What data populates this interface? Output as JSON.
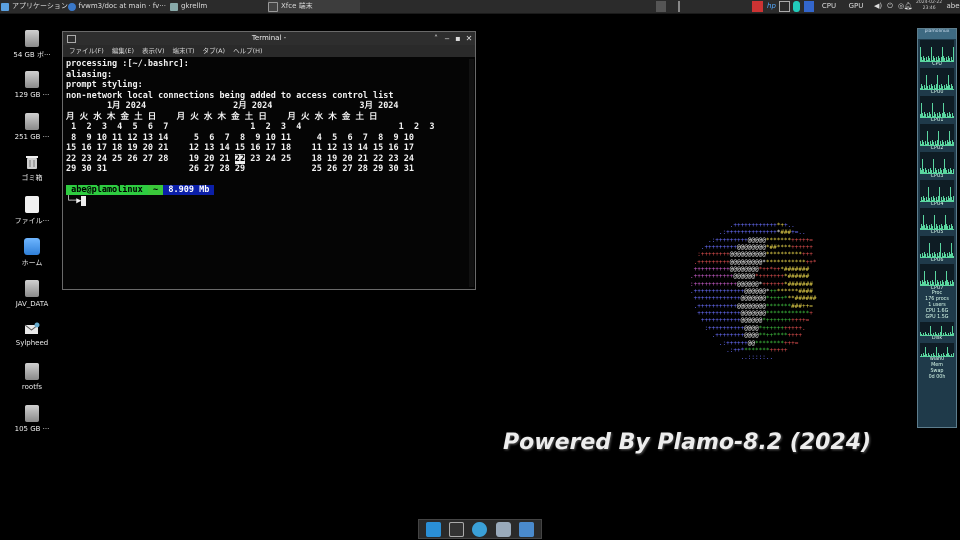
{
  "topbar": {
    "apps_menu": "アプリケーション",
    "tasks": [
      {
        "label": "fvwm3/doc at main · fv···"
      },
      {
        "label": "gkrellm"
      },
      {
        "label": "Xfce 端末"
      }
    ],
    "tray": {
      "cpu": "CPU",
      "gpu": "GPU",
      "user": "abe"
    },
    "clock": {
      "date": "2024-02-22",
      "time": "23:46"
    }
  },
  "desktop_icons": [
    {
      "label": "54 GB ボ···"
    },
    {
      "label": "129 GB ···"
    },
    {
      "label": "251 GB ···"
    },
    {
      "label": "ゴミ箱"
    },
    {
      "label": "ファイル···"
    },
    {
      "label": "ホーム"
    },
    {
      "label": "JAV_DATA"
    },
    {
      "label": "Sylpheed"
    },
    {
      "label": "rootfs"
    },
    {
      "label": "105 GB ···"
    }
  ],
  "terminal": {
    "title": "Terminal -",
    "menu": [
      "ファイル(F)",
      "編集(E)",
      "表示(V)",
      "端末(T)",
      "タブ(A)",
      "ヘルプ(H)"
    ],
    "lines": [
      "processing :[~/.bashrc]:",
      "aliasing:",
      "prompt styling:",
      "non-network local connections being added to access control list"
    ],
    "calendar": [
      "        1月 2024                 2月 2024                 3月 2024",
      "月 火 水 木 金 土 日    月 火 水 木 金 土 日    月 火 水 木 金 土 日",
      " 1  2  3  4  5  6  7                1  2  3  4                   1  2  3",
      " 8  9 10 11 12 13 14     5  6  7  8  9 10 11     4  5  6  7  8  9 10",
      "15 16 17 18 19 20 21    12 13 14 15 16 17 18    11 12 13 14 15 16 17"
    ],
    "cal_row5_a": "22 23 24 25 26 27 28    19 20 21 ",
    "cal_today": "22",
    "cal_row5_b": " 23 24 25    18 19 20 21 22 23 24",
    "cal_row6": "29 30 31                26 27 28 29             25 26 27 28 29 30 31",
    "prompt": {
      "user": " abe@plamolinux ",
      "dir": " ~ ",
      "size": " 8.909 Mb "
    },
    "prompt2": "└─▶"
  },
  "powered_by": "Powered By Plamo-8.2 (2024)",
  "gkrellm": {
    "host": "plamolinux",
    "cpu_labels": [
      "CPU",
      "CPU0",
      "CPU1",
      "CPU2",
      "CPU3",
      "CPU4",
      "CPU5",
      "CPU6",
      "CPU7"
    ],
    "procs": "Proc",
    "procs_count": "176 procs",
    "users": "1 users",
    "temps": "CPU 1.6G",
    "gpu": "GPU 1.5G",
    "disk": "Disk",
    "net": "wlan0",
    "mem": "Mem",
    "swap": "Swap",
    "uptime": "0d 00h"
  },
  "colors": {
    "panel": "#2b2b2b",
    "terminal_bg": "#050505",
    "prompt_green": "#2ecc40",
    "prompt_blue": "#0b1fa8",
    "gkrellm_bg": "#1f3a4a"
  }
}
